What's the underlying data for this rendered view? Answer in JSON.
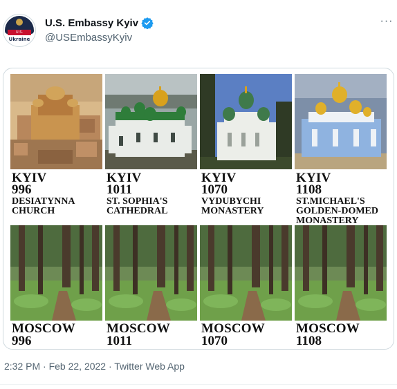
{
  "account": {
    "display_name": "U.S. Embassy Kyiv",
    "handle": "@USEmbassyKyiv",
    "avatar_ribbon": "U.S. EMBASSY",
    "avatar_country": "Ukraine",
    "verified_color": "#1d9bf0"
  },
  "more_label": "···",
  "panels": {
    "top": [
      {
        "city": "KYIV",
        "year": "996",
        "name": "DESIATYNNA CHURCH",
        "name_lines": [
          "DESIATYNNA",
          "CHURCH"
        ]
      },
      {
        "city": "KYIV",
        "year": "1011",
        "name": "ST. SOPHIA'S CATHEDRAL",
        "name_lines": [
          "ST. SOPHIA'S",
          "CATHEDRAL"
        ]
      },
      {
        "city": "KYIV",
        "year": "1070",
        "name": "VYDUBYCHI MONASTERY",
        "name_lines": [
          "VYDUBYCHI",
          "MONASTERY"
        ]
      },
      {
        "city": "KYIV",
        "year": "1108",
        "name": "ST.MICHAEL'S GOLDEN-DOMED MONASTERY",
        "name_lines": [
          "ST.MICHAEL'S",
          "GOLDEN-DOMED",
          "MONASTERY"
        ]
      }
    ],
    "bottom": [
      {
        "city": "MOSCOW",
        "year": "996"
      },
      {
        "city": "MOSCOW",
        "year": "1011"
      },
      {
        "city": "MOSCOW",
        "year": "1070"
      },
      {
        "city": "MOSCOW",
        "year": "1108"
      }
    ]
  },
  "tweet_meta": {
    "time": "2:32 PM",
    "date": "Feb 22, 2022",
    "source": "Twitter Web App",
    "line": "2:32 PM · Feb 22, 2022 · Twitter Web App"
  }
}
